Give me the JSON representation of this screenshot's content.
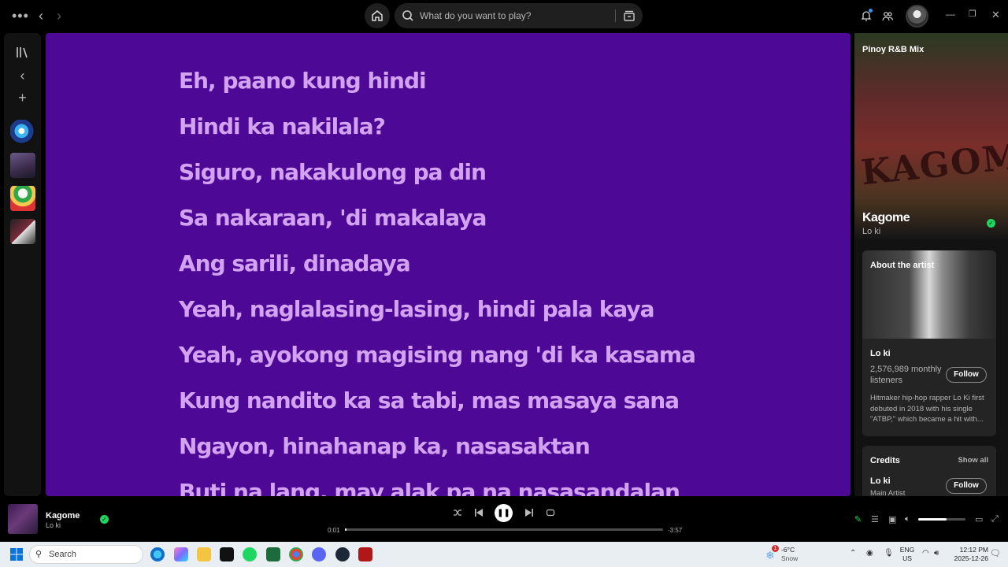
{
  "topbar": {
    "search_placeholder": "What do you want to play?"
  },
  "lyrics": [
    "Eh, paano kung hindi",
    "Hindi ka nakilala?",
    "Siguro, nakakulong pa din",
    "Sa nakaraan, 'di makalaya",
    "Ang sarili, dinadaya",
    "Yeah, naglalasing-lasing, hindi pala kaya",
    "Yeah, ayokong magising nang 'di ka kasama",
    "Kung nandito ka sa tabi, mas masaya sana",
    "Ngayon, hinahanap ka, nasasaktan",
    "Buti na lang, may alak pa na nasasandalan"
  ],
  "now_playing": {
    "playlist": "Pinoy R&B Mix",
    "cover_text": "KAGOME",
    "title": "Kagome",
    "artist": "Lo ki",
    "about_heading": "About the artist",
    "about_name": "Lo ki",
    "listeners": "2,576,989 monthly listeners",
    "follow_label": "Follow",
    "bio": "Hitmaker hip-hop rapper Lo Ki first debuted in 2018 with his single \"ATBP,\" which became a hit with...",
    "credits_heading": "Credits",
    "show_all": "Show all",
    "credit_name": "Lo ki",
    "credit_role": "Main Artist"
  },
  "player": {
    "title": "Kagome",
    "artist": "Lo ki",
    "time_current": "0:01",
    "time_remaining": "-3:57",
    "progress": 0.005,
    "volume": 0.6
  },
  "taskbar": {
    "search_label": "Search",
    "weather_temp": "-6°C",
    "weather_desc": "Snow",
    "weather_badge": "1",
    "lang_1": "ENG",
    "lang_2": "US",
    "time": "12:12 PM",
    "date": "2025-12-26"
  },
  "colors": {
    "lyrics_bg": "#4d0996",
    "lyrics_text": "#d3a2f0",
    "accent_green": "#1ed760"
  }
}
